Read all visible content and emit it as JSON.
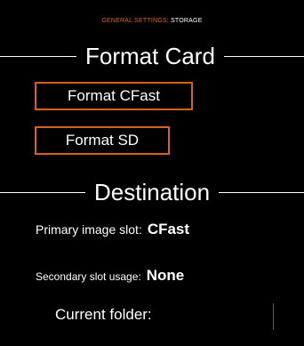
{
  "breadcrumb": {
    "section": "GENERAL SETTINGS:",
    "page": "STORAGE",
    "accent_color": "#e0681c"
  },
  "format_card": {
    "title": "Format Card",
    "buttons": {
      "cfast": "Format CFast",
      "sd": "Format SD"
    },
    "button_border_color": "#d9621a"
  },
  "destination": {
    "title": "Destination",
    "primary_slot": {
      "label": "Primary image slot:",
      "value": "CFast"
    },
    "secondary_usage": {
      "label": "Secondary slot usage:",
      "value": "None"
    },
    "current_folder": {
      "label": "Current folder:",
      "value": ""
    }
  }
}
